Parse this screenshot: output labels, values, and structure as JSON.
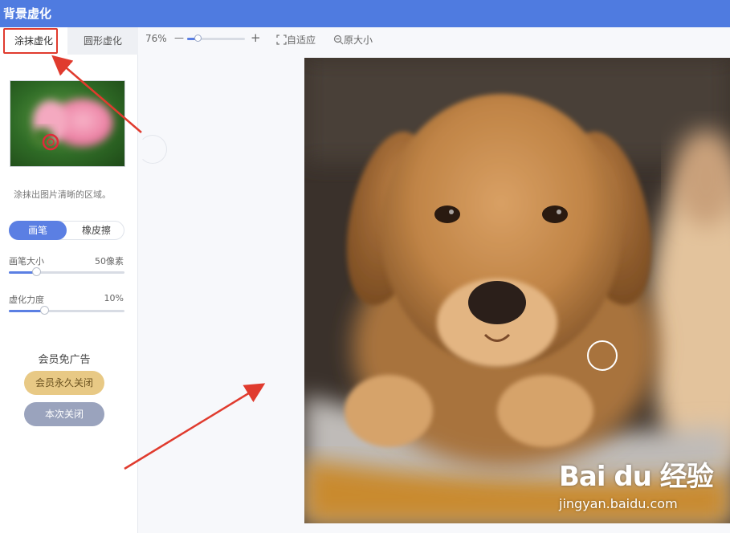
{
  "app": {
    "title": "背景虚化"
  },
  "tabs": [
    {
      "label": "涂抹虚化"
    },
    {
      "label": "圆形虚化"
    }
  ],
  "sidebar": {
    "hint": "涂抹出图片清晰的区域。",
    "modes": [
      {
        "label": "画笔"
      },
      {
        "label": "橡皮擦"
      }
    ],
    "brush_size": {
      "label": "画笔大小",
      "value": "50像素",
      "level_percent": 24
    },
    "blur_strength": {
      "label": "虚化力度",
      "value": "10%",
      "level_percent": 31
    },
    "vip": {
      "title": "会员免广告",
      "permanent_close": "会员永久关闭",
      "close_once": "本次关闭"
    }
  },
  "toolbar": {
    "zoom_label": "76%",
    "zoom_level_percent": 20,
    "minus": "—",
    "plus": "+",
    "fit": "自适应",
    "original_size": "原大小"
  },
  "watermark": {
    "logo_text": "Bai du 经验",
    "url": "jingyan.baidu.com"
  },
  "colors": {
    "titlebar": "#4f7be0",
    "accent": "#5b7fe3",
    "highlight": "#e03b2e",
    "vip_gold": "#e8c985",
    "vip_grey": "#9aa3bd"
  }
}
